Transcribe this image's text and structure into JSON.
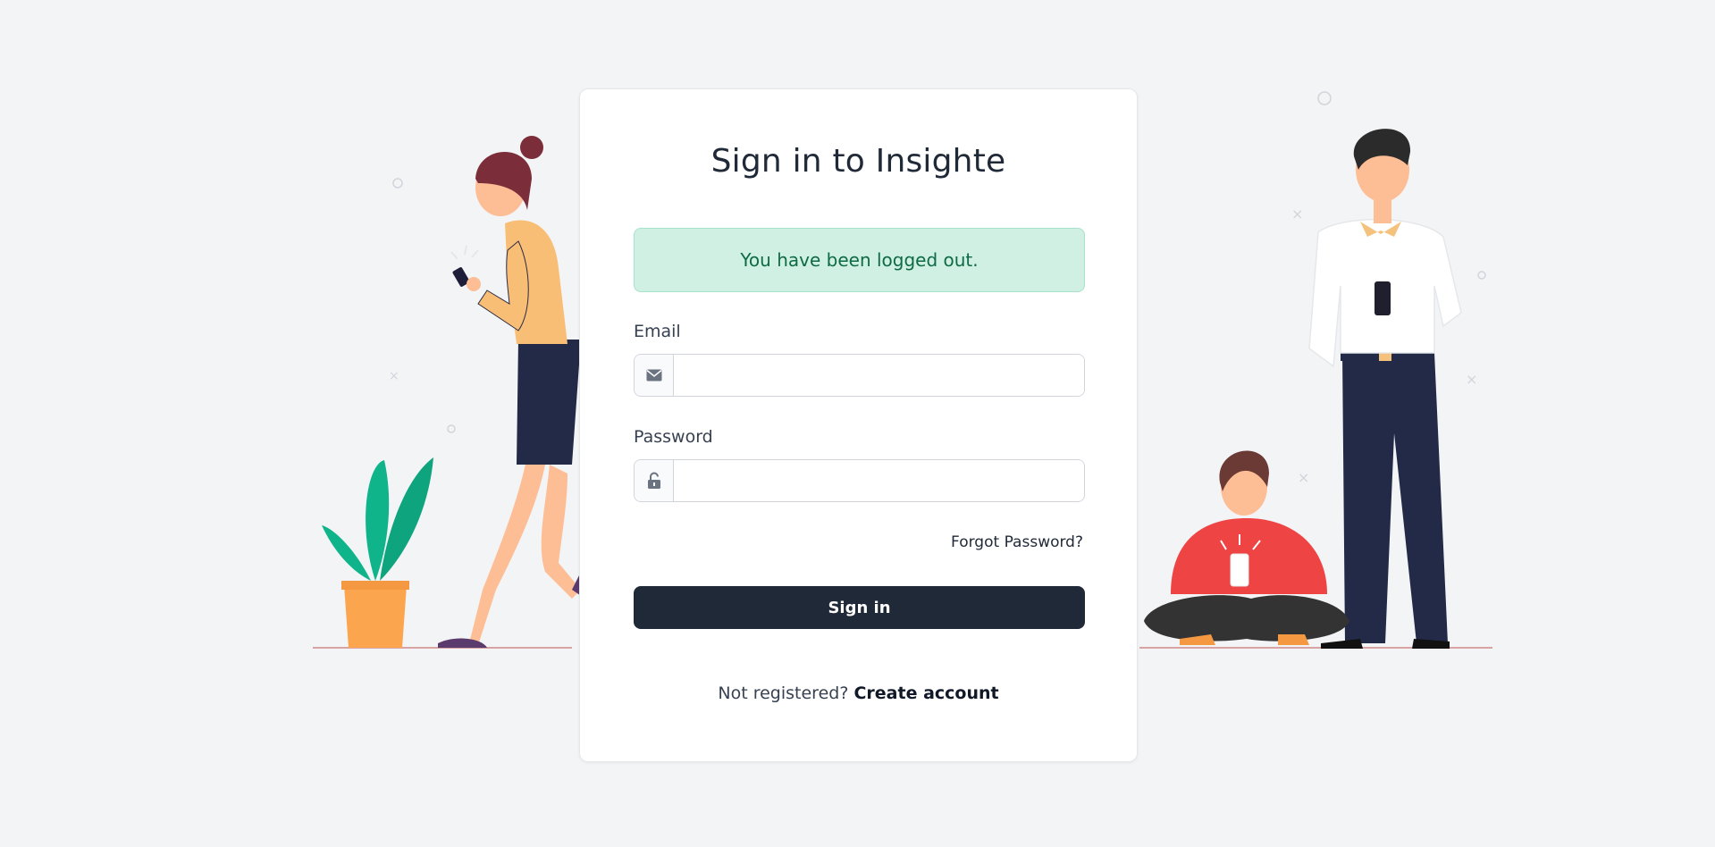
{
  "page": {
    "title": "Sign in to Insighte",
    "alert": "You have been logged out.",
    "email_label": "Email",
    "email_value": "",
    "password_label": "Password",
    "password_value": "",
    "forgot_password": "Forgot Password?",
    "sign_in_button": "Sign in",
    "not_registered": "Not registered?",
    "create_account": "Create account"
  },
  "icons": {
    "email": "envelope-icon",
    "password": "unlock-icon"
  },
  "colors": {
    "background": "#f3f4f6",
    "alert_bg": "#cff0e3",
    "alert_text": "#0f6b45",
    "button_bg": "#1f2937"
  }
}
